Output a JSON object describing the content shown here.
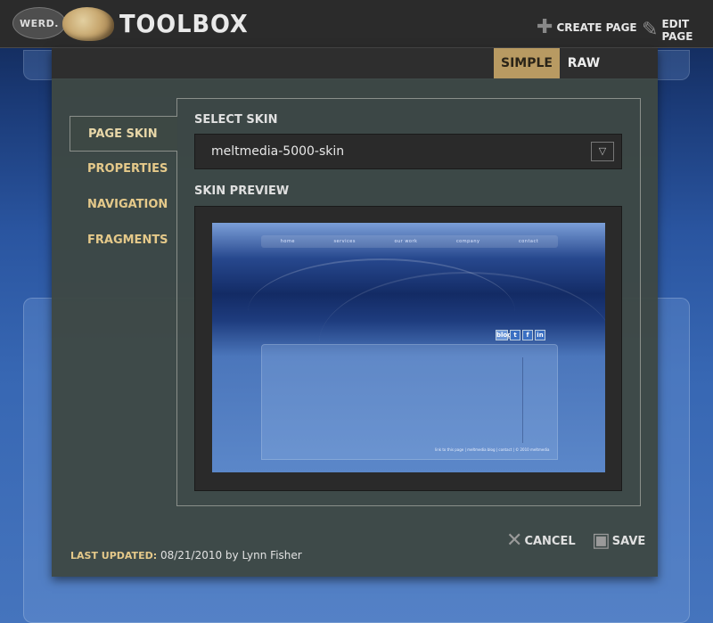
{
  "header": {
    "werd_label": "WERD.",
    "brand": "TOOLBOX",
    "create_page": "CREATE PAGE",
    "edit_page": "EDIT PAGE"
  },
  "modes": {
    "simple": "SIMPLE",
    "raw": "RAW",
    "active": "SIMPLE"
  },
  "sidebar": {
    "items": [
      {
        "label": "PAGE SKIN",
        "active": true
      },
      {
        "label": "PROPERTIES",
        "active": false
      },
      {
        "label": "NAVIGATION",
        "active": false
      },
      {
        "label": "FRAGMENTS",
        "active": false
      }
    ]
  },
  "skin": {
    "select_label": "SELECT SKIN",
    "selected": "meltmedia-5000-skin",
    "preview_label": "SKIN PREVIEW",
    "preview_nav": [
      "home",
      "services",
      "our work",
      "company",
      "contact"
    ],
    "preview_social": [
      "blog",
      "t",
      "f",
      "in"
    ],
    "preview_footer": "link to this page | meltmedia blog | contact | © 2010 meltmedia"
  },
  "actions": {
    "cancel": "CANCEL",
    "save": "SAVE"
  },
  "footer": {
    "updated_label": "LAST UPDATED:",
    "updated_value": "08/21/2010 by Lynn Fisher"
  },
  "colors": {
    "accent": "#b89a62",
    "nav_text": "#e5c98a",
    "modal_bg": "#3d4844"
  }
}
